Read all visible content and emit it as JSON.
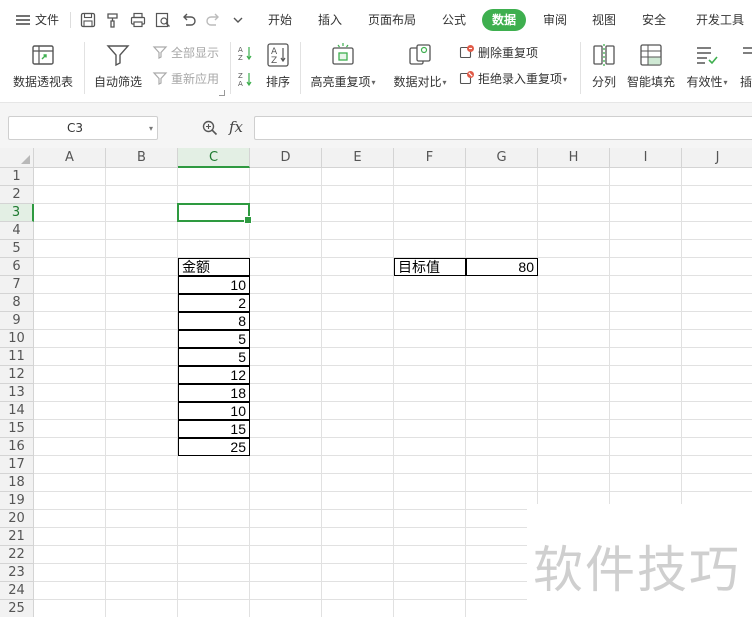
{
  "menubar": {
    "file_label": "文件",
    "tabs": [
      "开始",
      "插入",
      "页面布局",
      "公式",
      "数据",
      "审阅",
      "视图",
      "安全",
      "开发工具"
    ],
    "active_tab": "数据"
  },
  "ribbon": {
    "pivot": "数据透视表",
    "autofilter": "自动筛选",
    "show_all": "全部显示",
    "reapply": "重新应用",
    "sort": "排序",
    "highlight_dup": "高亮重复项",
    "compare": "数据对比",
    "remove_dup": "删除重复项",
    "reject_dup": "拒绝录入重复项",
    "split": "分列",
    "smart_fill": "智能填充",
    "validity": "有效性",
    "truncated": "插"
  },
  "formula_bar": {
    "name_box": "C3",
    "fx": "fx",
    "formula": ""
  },
  "sheet": {
    "columns": [
      "A",
      "B",
      "C",
      "D",
      "E",
      "F",
      "G",
      "H",
      "I",
      "J"
    ],
    "rows": [
      "1",
      "2",
      "3",
      "4",
      "5",
      "6",
      "7",
      "8",
      "9",
      "10",
      "11",
      "12",
      "13",
      "14",
      "15",
      "16",
      "17",
      "18",
      "19",
      "20",
      "21",
      "22",
      "23",
      "24",
      "25"
    ],
    "selected_column": "C",
    "selected_row": "3",
    "amount_header": "金额",
    "amounts": [
      "10",
      "2",
      "8",
      "5",
      "5",
      "12",
      "18",
      "10",
      "15",
      "25"
    ],
    "target_label": "目标值",
    "target_value": "80"
  },
  "watermark": "软件技巧"
}
